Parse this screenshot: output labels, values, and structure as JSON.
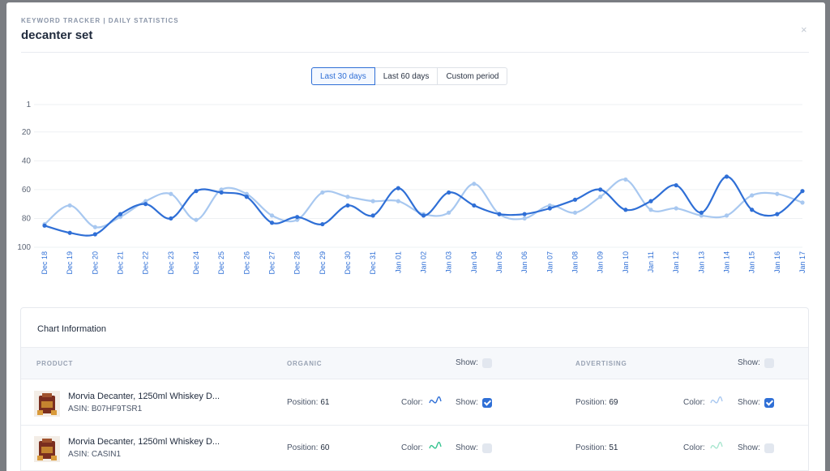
{
  "header": {
    "subtitle": "KEYWORD TRACKER | DAILY STATISTICS",
    "title": "decanter set",
    "close_label": "×"
  },
  "period_buttons": [
    {
      "label": "Last 30 days",
      "active": true
    },
    {
      "label": "Last 60 days",
      "active": false
    },
    {
      "label": "Custom period",
      "active": false
    }
  ],
  "chart_data": {
    "type": "line",
    "x": [
      "Dec 18",
      "Dec 19",
      "Dec 20",
      "Dec 21",
      "Dec 22",
      "Dec 23",
      "Dec 24",
      "Dec 25",
      "Dec 26",
      "Dec 27",
      "Dec 28",
      "Dec 29",
      "Dec 30",
      "Dec 31",
      "Jan 01",
      "Jan 02",
      "Jan 03",
      "Jan 04",
      "Jan 05",
      "Jan 06",
      "Jan 07",
      "Jan 08",
      "Jan 09",
      "Jan 10",
      "Jan 11",
      "Jan 12",
      "Jan 13",
      "Jan 14",
      "Jan 15",
      "Jan 16",
      "Jan 17"
    ],
    "yticks": [
      1,
      20,
      40,
      60,
      80,
      100
    ],
    "ylim": [
      1,
      100
    ],
    "y_inverted": true,
    "grid": true,
    "series": [
      {
        "color": "#a8c8f0",
        "values": [
          84,
          71,
          86,
          79,
          68,
          63,
          81,
          60,
          63,
          78,
          81,
          62,
          65,
          68,
          68,
          77,
          76,
          56,
          77,
          80,
          71,
          76,
          65,
          53,
          74,
          73,
          78,
          78,
          64,
          63,
          69
        ]
      },
      {
        "color": "#2f6fd6",
        "values": [
          85,
          90,
          91,
          77,
          70,
          80,
          61,
          62,
          65,
          83,
          79,
          84,
          71,
          78,
          59,
          78,
          62,
          71,
          77,
          77,
          73,
          67,
          60,
          74,
          68,
          57,
          76,
          51,
          74,
          77,
          61
        ]
      }
    ]
  },
  "info": {
    "title": "Chart Information",
    "columns": {
      "product": "PRODUCT",
      "organic": "ORGANIC",
      "advertising": "ADVERTISING",
      "show_label": "Show:"
    },
    "rows": [
      {
        "name": "Morvia Decanter, 1250ml Whiskey D...",
        "asin": "ASIN: B07HF9TSR1",
        "organic_position_label": "Position:",
        "organic_position": "61",
        "color_label": "Color:",
        "organic_color": "#2f6fd6",
        "organic_show": true,
        "ad_position_label": "Position:",
        "ad_position": "69",
        "ad_color": "#a8c8f0",
        "ad_show": true,
        "show_label": "Show:"
      },
      {
        "name": "Morvia Decanter, 1250ml Whiskey D...",
        "asin": "ASIN: CASIN1",
        "organic_position_label": "Position:",
        "organic_position": "60",
        "color_label": "Color:",
        "organic_color": "#34c38f",
        "organic_show": false,
        "ad_position_label": "Position:",
        "ad_position": "51",
        "ad_color": "#a8e6cf",
        "ad_show": false,
        "show_label": "Show:"
      }
    ]
  }
}
